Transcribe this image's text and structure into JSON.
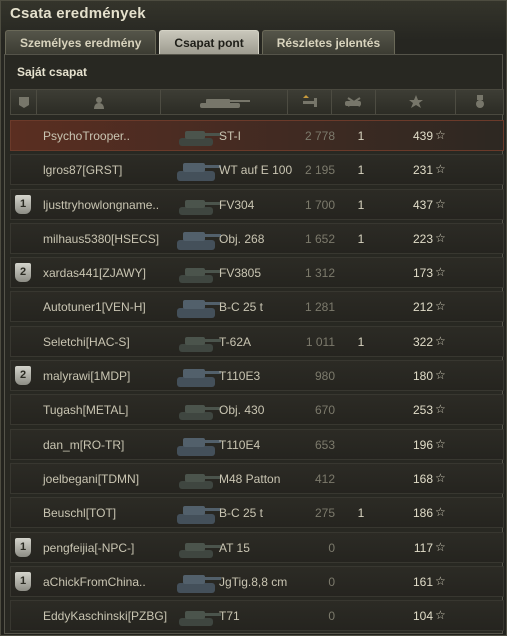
{
  "window": {
    "title": "Csata eredmények"
  },
  "tabs": [
    {
      "label": "Személyes eredmény",
      "active": false
    },
    {
      "label": "Csapat pont",
      "active": true
    },
    {
      "label": "Részletes jelentés",
      "active": false
    }
  ],
  "section": {
    "title": "Saját csapat"
  },
  "columns": [
    {
      "icon": "badge-icon"
    },
    {
      "icon": "player-icon"
    },
    {
      "icon": "tank-icon"
    },
    {
      "icon": "damage-icon",
      "sorted": true
    },
    {
      "icon": "frags-icon"
    },
    {
      "icon": "experience-star-icon"
    },
    {
      "icon": "medal-icon"
    }
  ],
  "colors": {
    "self_row": "#5a2e21",
    "text": "#c9c5b2",
    "dim_points": "#7c7a6c"
  },
  "rows": [
    {
      "badge": "",
      "player": "PsychoTrooper..",
      "vehicle": "ST-I",
      "points": "2 778",
      "kills": "1",
      "score": "439",
      "star": "☆",
      "self": true
    },
    {
      "badge": "",
      "player": "lgros87[GRST]",
      "vehicle": "WT auf E 100",
      "points": "2 195",
      "kills": "1",
      "score": "231",
      "star": "☆"
    },
    {
      "badge": "1",
      "player": "ljusttryhowlongname..",
      "vehicle": "FV304",
      "points": "1 700",
      "kills": "1",
      "score": "437",
      "star": "☆"
    },
    {
      "badge": "",
      "player": "milhaus5380[HSECS]",
      "vehicle": "Obj. 268",
      "points": "1 652",
      "kills": "1",
      "score": "223",
      "star": "☆"
    },
    {
      "badge": "2",
      "player": "xardas441[ZJAWY]",
      "vehicle": "FV3805",
      "points": "1 312",
      "kills": "",
      "score": "173",
      "star": "☆"
    },
    {
      "badge": "",
      "player": "Autotuner1[VEN-H]",
      "vehicle": "B-C 25 t",
      "points": "1 281",
      "kills": "",
      "score": "212",
      "star": "☆"
    },
    {
      "badge": "",
      "player": "Seletchi[HAC-S]",
      "vehicle": "T-62A",
      "points": "1 011",
      "kills": "1",
      "score": "322",
      "star": "☆"
    },
    {
      "badge": "2",
      "player": "malyrawi[1MDP]",
      "vehicle": "T110E3",
      "points": "980",
      "kills": "",
      "score": "180",
      "star": "☆"
    },
    {
      "badge": "",
      "player": "Tugash[METAL]",
      "vehicle": "Obj. 430",
      "points": "670",
      "kills": "",
      "score": "253",
      "star": "☆"
    },
    {
      "badge": "",
      "player": "dan_m[RO-TR]",
      "vehicle": "T110E4",
      "points": "653",
      "kills": "",
      "score": "196",
      "star": "☆"
    },
    {
      "badge": "",
      "player": "joelbegani[TDMN]",
      "vehicle": "M48 Patton",
      "points": "412",
      "kills": "",
      "score": "168",
      "star": "☆"
    },
    {
      "badge": "",
      "player": "Beuschl[TOT]",
      "vehicle": "B-C 25 t",
      "points": "275",
      "kills": "1",
      "score": "186",
      "star": "☆"
    },
    {
      "badge": "1",
      "player": "pengfeijia[-NPC-]",
      "vehicle": "AT 15",
      "points": "0",
      "kills": "",
      "score": "117",
      "star": "☆"
    },
    {
      "badge": "1",
      "player": "aChickFromChina..",
      "vehicle": "JgTig.8,8 cm",
      "points": "0",
      "kills": "",
      "score": "161",
      "star": "☆"
    },
    {
      "badge": "",
      "player": "EddyKaschinski[PZBG]",
      "vehicle": "T71",
      "points": "0",
      "kills": "",
      "score": "104",
      "star": "☆"
    }
  ]
}
